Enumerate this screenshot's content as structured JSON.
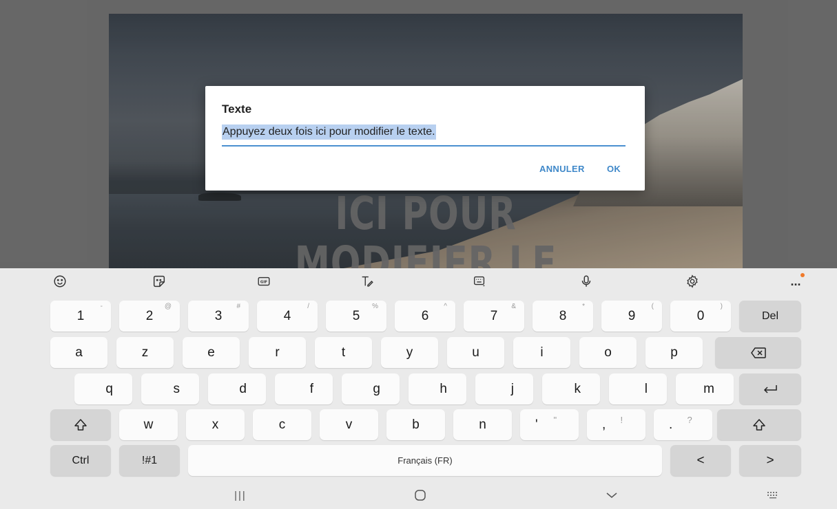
{
  "canvas": {
    "overlay_text_line_1": "ICI POUR",
    "overlay_text_line_2": "MODIFIER LE"
  },
  "dialog": {
    "title": "Texte",
    "input_value": "Appuyez deux fois ici pour modifier le texte.",
    "cancel_label": "ANNULER",
    "ok_label": "OK"
  },
  "keyboard_toolbar": {
    "icons": [
      "emoji-icon",
      "sticker-icon",
      "gif-icon",
      "handwriting-icon",
      "keyboard-layout-icon",
      "microphone-icon",
      "settings-icon",
      "more-icon"
    ],
    "gif_label": "GIF",
    "more_label": "...",
    "notification_color": "#f07a2a"
  },
  "keyboard": {
    "number_row": [
      {
        "key": "1",
        "hint": "-"
      },
      {
        "key": "2",
        "hint": "@"
      },
      {
        "key": "3",
        "hint": "#"
      },
      {
        "key": "4",
        "hint": "/"
      },
      {
        "key": "5",
        "hint": "%"
      },
      {
        "key": "6",
        "hint": "^"
      },
      {
        "key": "7",
        "hint": "&"
      },
      {
        "key": "8",
        "hint": "*"
      },
      {
        "key": "9",
        "hint": "("
      },
      {
        "key": "0",
        "hint": ")"
      }
    ],
    "del_label": "Del",
    "row_a": [
      "a",
      "z",
      "e",
      "r",
      "t",
      "y",
      "u",
      "i",
      "o",
      "p"
    ],
    "row_q": [
      "q",
      "s",
      "d",
      "f",
      "g",
      "h",
      "j",
      "k",
      "l",
      "m"
    ],
    "row_w": [
      "w",
      "x",
      "c",
      "v",
      "b",
      "n"
    ],
    "punct_keys": [
      {
        "main": "'",
        "hint": "\""
      },
      {
        "main": ",",
        "hint": "!"
      },
      {
        "main": ".",
        "hint": "?"
      }
    ],
    "ctrl_label": "Ctrl",
    "symbols_label": "!#1",
    "space_label": "Français (FR)",
    "left_arrow": "<",
    "right_arrow": ">"
  },
  "nav_bar": {
    "recents_label": "|||",
    "home_icon": "home-icon",
    "back_icon": "hide-keyboard-icon",
    "keyboard_switch_icon": "keyboard-switch-icon"
  },
  "colors": {
    "accent": "#3f88c9",
    "selection": "#b8d0f0",
    "underline": "#4a8fd0",
    "keyboard_bg": "#eaeaea",
    "key_bg": "#fbfbfb",
    "fn_key_bg": "#d5d5d5"
  }
}
